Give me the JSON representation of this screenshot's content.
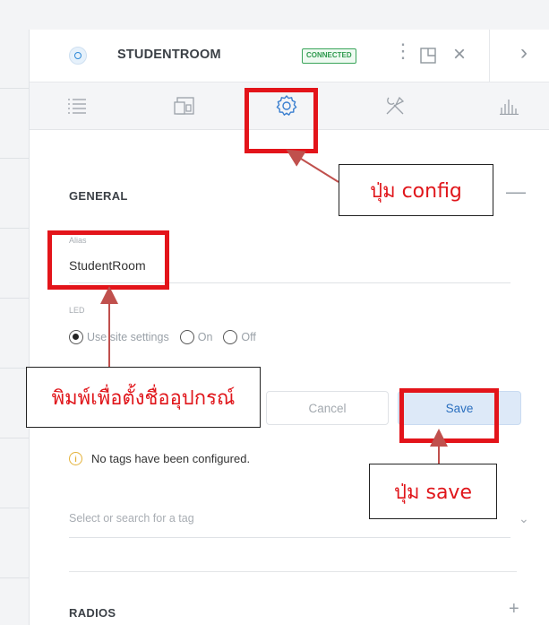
{
  "device": {
    "name": "STUDENTROOM",
    "status_badge": "CONNECTED",
    "more_icon": "more-vertical-icon",
    "popout_icon": "popout-icon",
    "close_glyph": "×",
    "next_glyph": "›"
  },
  "tabs": [
    {
      "name": "tab-details",
      "icon": "list-icon"
    },
    {
      "name": "tab-statistics",
      "icon": "device-icon"
    },
    {
      "name": "tab-config",
      "icon": "gear-icon",
      "active": true
    },
    {
      "name": "tab-tools",
      "icon": "tools-icon"
    },
    {
      "name": "tab-insights",
      "icon": "bar-chart-icon"
    }
  ],
  "general": {
    "title": "GENERAL",
    "collapse_glyph": "—",
    "alias_label": "Alias",
    "alias_value": "StudentRoom",
    "led_label": "LED",
    "led_options": [
      "Use site settings",
      "On",
      "Off"
    ],
    "led_selected": "Use site settings"
  },
  "buttons": {
    "cancel": "Cancel",
    "save": "Save"
  },
  "tags": {
    "info_glyph": "i",
    "message": "No tags have been configured.",
    "search_placeholder": "Select or search for a tag",
    "chevron_glyph": "⌄"
  },
  "radios": {
    "title": "RADIOS",
    "expand_glyph": "+"
  },
  "annotations": {
    "config": "ปุ่ม config",
    "rename": "พิมพ์เพื่อตั้งชื่ออุปกรณ์",
    "save": "ปุ่ม save"
  },
  "colors": {
    "highlight": "#e3141a",
    "annotation_text": "#e0161b",
    "arrow": "#c0504d",
    "save_button_bg": "#dde9f8",
    "connected": "#2f9a4f"
  }
}
